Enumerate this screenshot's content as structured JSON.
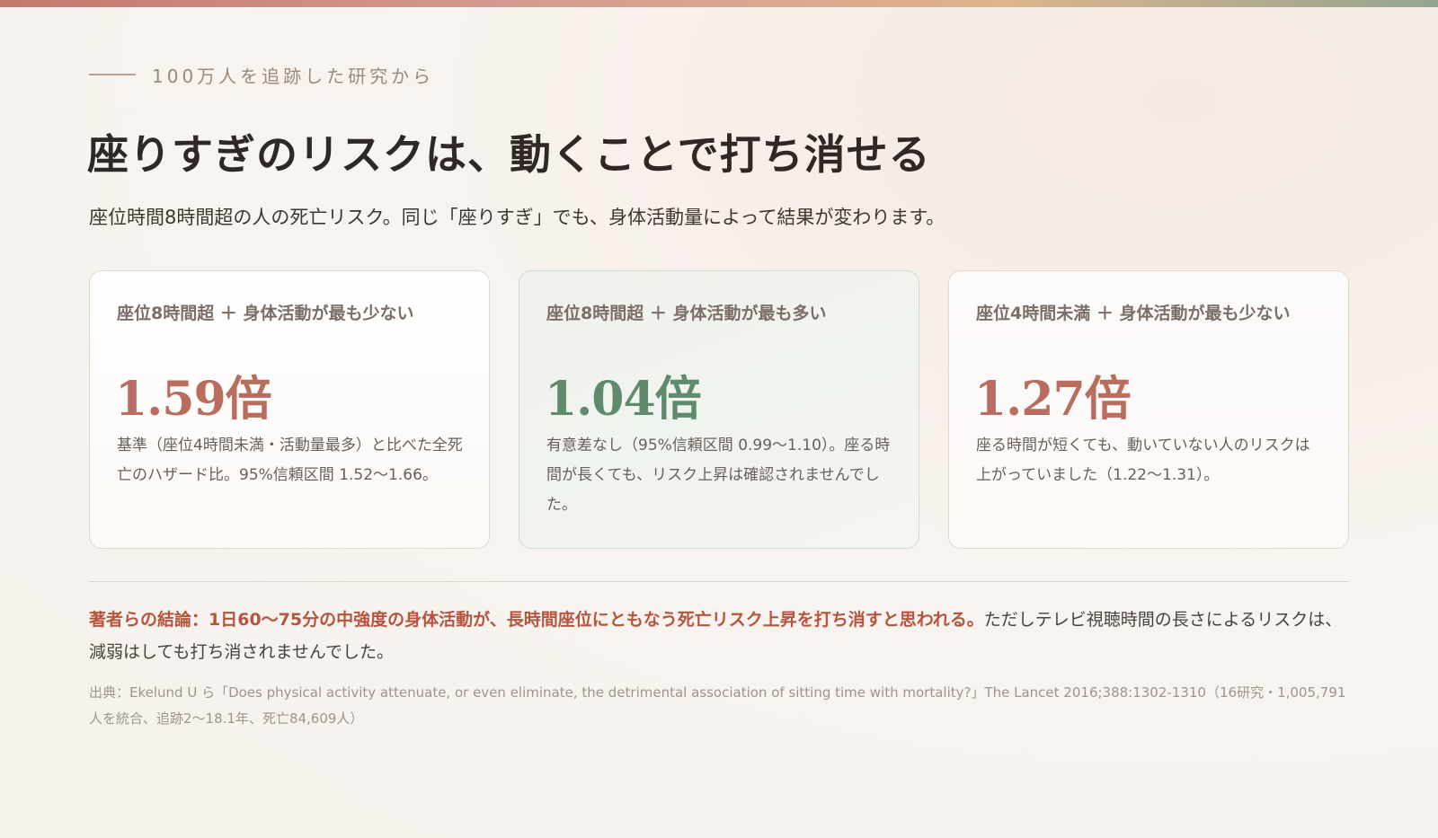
{
  "eyebrow": "100万人を追跡した研究から",
  "title": "座りすぎのリスクは、動くことで打ち消せる",
  "subtitle": "座位時間8時間超の人の死亡リスク。同じ「座りすぎ」でも、身体活動量によって結果が変わります。",
  "cards": [
    {
      "label": "座位8時間超 ＋ 身体活動が最も少ない",
      "value": "1.59倍",
      "desc": "基準（座位4時間未満・活動量最多）と比べた全死亡のハザード比。95%信頼区間 1.52〜1.66。",
      "accent": "#b86d5e"
    },
    {
      "label": "座位8時間超 ＋ 身体活動が最も多い",
      "value": "1.04倍",
      "desc": "有意差なし（95%信頼区間 0.99〜1.10）。座る時間が長くても、リスク上昇は確認されませんでした。",
      "accent": "#5f8a6b"
    },
    {
      "label": "座位4時間未満 ＋ 身体活動が最も少ない",
      "value": "1.27倍",
      "desc": "座る時間が短くても、動いていない人のリスクは上がっていました（1.22〜1.31）。",
      "accent": "#b86d5e"
    }
  ],
  "conclusion": {
    "strong": "著者らの結論：1日60〜75分の中強度の身体活動が、長時間座位にともなう死亡リスク上昇を打ち消すと思われる。",
    "rest": "ただしテレビ視聴時間の長さによるリスクは、減弱はしても打ち消されませんでした。"
  },
  "source": "出典：Ekelund U ら「Does physical activity attenuate, or even eliminate, the detrimental association of sitting time with mortality?」The Lancet 2016;388:1302-1310（16研究・1,005,791人を統合、追跡2〜18.1年、死亡84,609人）"
}
